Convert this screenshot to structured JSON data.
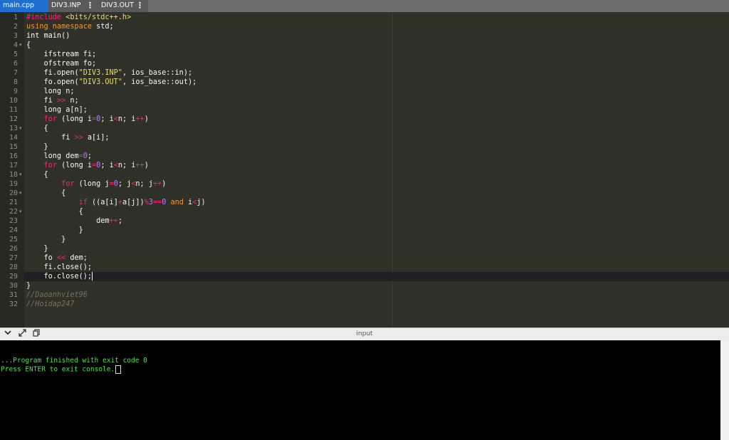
{
  "tabs": [
    {
      "label": "main.cpp",
      "active": true
    },
    {
      "label": "DIV3.INP",
      "active": false
    },
    {
      "label": "DIV3.OUT",
      "active": false
    }
  ],
  "editor": {
    "active_line": 29,
    "fold_lines": [
      4,
      13,
      18,
      20,
      22
    ],
    "lines": [
      [
        [
          "prep",
          "#include "
        ],
        [
          "inc",
          "<bits/stdc++.h>"
        ]
      ],
      [
        [
          "tkw",
          "using namespace"
        ],
        [
          "p",
          " std;"
        ]
      ],
      [
        [
          "p",
          "int main()"
        ]
      ],
      [
        [
          "p",
          "{"
        ]
      ],
      [
        [
          "p",
          "    ifstream fi;"
        ]
      ],
      [
        [
          "p",
          "    ofstream fo;"
        ]
      ],
      [
        [
          "p",
          "    fi.open("
        ],
        [
          "str",
          "\"DIV3.INP\""
        ],
        [
          "p",
          ", ios_base::in);"
        ]
      ],
      [
        [
          "p",
          "    fo.open("
        ],
        [
          "str",
          "\"DIV3.OUT\""
        ],
        [
          "p",
          ", ios_base::out);"
        ]
      ],
      [
        [
          "p",
          "    long n;"
        ]
      ],
      [
        [
          "p",
          "    fi "
        ],
        [
          "op",
          ">>"
        ],
        [
          "p",
          " n;"
        ]
      ],
      [
        [
          "p",
          "    long a[n];"
        ]
      ],
      [
        [
          "p",
          "    "
        ],
        [
          "kw",
          "for"
        ],
        [
          "p",
          " (long i"
        ],
        [
          "op",
          "="
        ],
        [
          "num",
          "0"
        ],
        [
          "p",
          "; i"
        ],
        [
          "op",
          "<"
        ],
        [
          "p",
          "n; i"
        ],
        [
          "op",
          "++"
        ],
        [
          "p",
          ")"
        ]
      ],
      [
        [
          "p",
          "    {"
        ]
      ],
      [
        [
          "p",
          "        fi "
        ],
        [
          "op",
          ">>"
        ],
        [
          "p",
          " a[i];"
        ]
      ],
      [
        [
          "p",
          "    }"
        ]
      ],
      [
        [
          "p",
          "    long dem"
        ],
        [
          "op",
          "="
        ],
        [
          "num",
          "0"
        ],
        [
          "p",
          ";"
        ]
      ],
      [
        [
          "p",
          "    "
        ],
        [
          "kw",
          "for"
        ],
        [
          "p",
          " (long i"
        ],
        [
          "op",
          "="
        ],
        [
          "num",
          "0"
        ],
        [
          "p",
          "; i"
        ],
        [
          "op",
          "<"
        ],
        [
          "p",
          "n; i"
        ],
        [
          "op",
          "++"
        ],
        [
          "p",
          ")"
        ]
      ],
      [
        [
          "p",
          "    {"
        ]
      ],
      [
        [
          "p",
          "        "
        ],
        [
          "kw",
          "for"
        ],
        [
          "p",
          " (long j"
        ],
        [
          "op",
          "="
        ],
        [
          "num",
          "0"
        ],
        [
          "p",
          "; j"
        ],
        [
          "op",
          "<"
        ],
        [
          "p",
          "n; j"
        ],
        [
          "op",
          "++"
        ],
        [
          "p",
          ")"
        ]
      ],
      [
        [
          "p",
          "        {"
        ]
      ],
      [
        [
          "p",
          "            "
        ],
        [
          "kw",
          "if"
        ],
        [
          "p",
          " ((a[i]"
        ],
        [
          "op",
          "+"
        ],
        [
          "p",
          "a[j])"
        ],
        [
          "op",
          "%"
        ],
        [
          "num",
          "3"
        ],
        [
          "op",
          "=="
        ],
        [
          "num",
          "0"
        ],
        [
          "p",
          " "
        ],
        [
          "tkw",
          "and"
        ],
        [
          "p",
          " i"
        ],
        [
          "op",
          "<"
        ],
        [
          "p",
          "j)"
        ]
      ],
      [
        [
          "p",
          "            {"
        ]
      ],
      [
        [
          "p",
          "                dem"
        ],
        [
          "op",
          "++"
        ],
        [
          "p",
          ";"
        ]
      ],
      [
        [
          "p",
          "            }"
        ]
      ],
      [
        [
          "p",
          "        }"
        ]
      ],
      [
        [
          "p",
          "    }"
        ]
      ],
      [
        [
          "p",
          "    fo "
        ],
        [
          "op",
          "<<"
        ],
        [
          "p",
          " dem;"
        ]
      ],
      [
        [
          "p",
          "    fi.close();"
        ]
      ],
      [
        [
          "p",
          "    fo.close();"
        ]
      ],
      [
        [
          "p",
          "}"
        ]
      ],
      [
        [
          "com",
          "//Daoanhviet96"
        ]
      ],
      [
        [
          "com",
          "//Hoidap247"
        ]
      ]
    ]
  },
  "toolbar": {
    "collapse_icon": "chevron-down-icon",
    "expand_icon": "expand-icon",
    "copy_icon": "copy-icon",
    "label": "input"
  },
  "console": {
    "lines": [
      "",
      "...Program finished with exit code 0",
      "Press ENTER to exit console."
    ]
  },
  "colors": {
    "active_tab": "#1e6fd0",
    "editor_bg": "#2f3129",
    "console_text": "#4fe34f"
  }
}
